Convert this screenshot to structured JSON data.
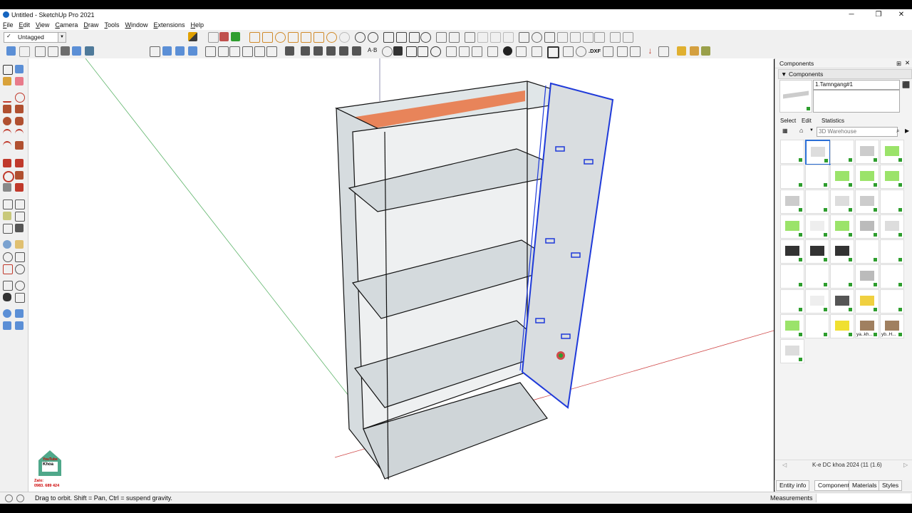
{
  "window": {
    "title": "Untitled - SketchUp Pro 2021",
    "minimize": "─",
    "maximize": "❐",
    "close": "✕"
  },
  "menu": [
    "File",
    "Edit",
    "View",
    "Camera",
    "Draw",
    "Tools",
    "Window",
    "Extensions",
    "Help"
  ],
  "tag_selector": {
    "checkmark": "✓",
    "value": "Untagged"
  },
  "panel": {
    "title": "Components",
    "section": "Components",
    "component_name": "1.Tamngang#1",
    "tabs": [
      "Select",
      "Edit",
      "Statistics"
    ],
    "search_placeholder": "3D Warehouse",
    "grid_labels": [
      "ya..kh...",
      "yb..H..."
    ],
    "collection_path": "K-e DC khoa 2024 (11  (1.6)"
  },
  "panel_tabs": [
    "Entity info",
    "Components",
    "Materials",
    "Styles"
  ],
  "status": {
    "hint": "Drag to orbit. Shift = Pan, Ctrl = suspend gravity.",
    "measurements_label": "Measurements"
  },
  "logo": {
    "channel": "YouTube",
    "name": "Khoa",
    "zalo_label": "Zalo:",
    "phone": "0983. 689 424"
  },
  "toolbar_text": {
    "ab": "A·B",
    "dxf": ".DXF"
  },
  "colors": {
    "selection_blue": "#1f3ad9",
    "highlight_orange": "#e8845a",
    "inference_green": "#2e9e2e",
    "axis_red": "#d04a4a"
  }
}
